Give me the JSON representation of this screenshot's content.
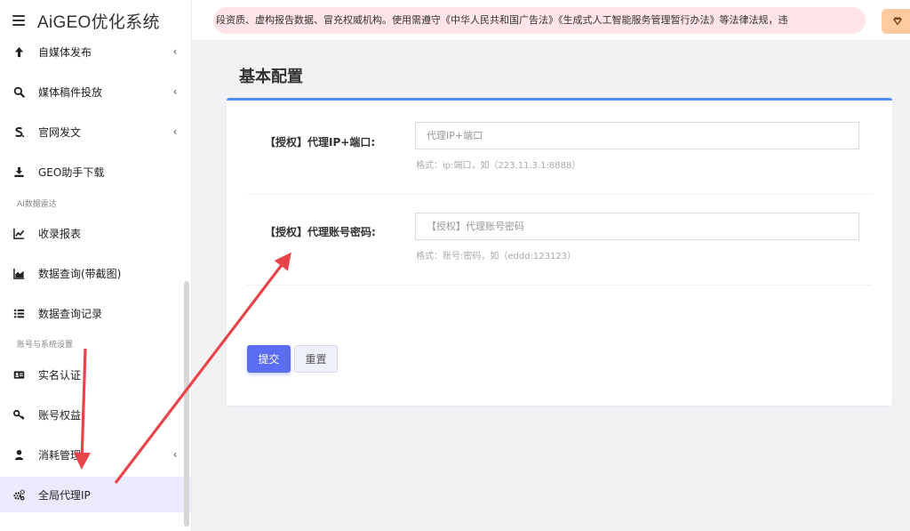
{
  "app": {
    "title": "AiGEO优化系统"
  },
  "sidebar": {
    "items": [
      {
        "label": "自媒体发布",
        "icon": "arrow-up-icon",
        "has_caret": true
      },
      {
        "label": "媒体稿件投放",
        "icon": "search-icon",
        "has_caret": true
      },
      {
        "label": "官网发文",
        "icon": "s-logo-icon",
        "has_caret": true
      },
      {
        "label": "GEO助手下载",
        "icon": "download-icon",
        "has_caret": false
      },
      {
        "label": "收录报表",
        "icon": "line-chart-icon",
        "has_caret": false
      },
      {
        "label": "数据查询(带截图)",
        "icon": "area-chart-icon",
        "has_caret": false
      },
      {
        "label": "数据查询记录",
        "icon": "list-icon",
        "has_caret": false
      },
      {
        "label": "实名认证",
        "icon": "id-card-icon",
        "has_caret": false
      },
      {
        "label": "账号权益",
        "icon": "key-icon",
        "has_caret": false
      },
      {
        "label": "消耗管理",
        "icon": "user-icon",
        "has_caret": true
      },
      {
        "label": "全局代理IP",
        "icon": "cogs-icon",
        "has_caret": false,
        "active": true
      }
    ],
    "sections": {
      "ai_radar": "AI数据雷达",
      "account_settings": "账号与系统设置"
    },
    "caret_glyph": "‹"
  },
  "topbar": {
    "notice": "段资质、虚构报告数据、冒充权威机构。使用需遵守《中华人民共和国广告法》《生成式人工智能服务管理暂行办法》等法律法规，违",
    "vip_icon": "diamond-icon"
  },
  "main": {
    "page_title": "基本配置",
    "fields": [
      {
        "label": "【授权】代理IP+端口:",
        "placeholder": "代理IP+端口",
        "value": "",
        "hint": "格式：ip:端口，如（223.11.3.1:8888）"
      },
      {
        "label": "【授权】代理账号密码:",
        "placeholder": "【授权】代理账号密码",
        "value": "",
        "hint": "格式：账号:密码，如（eddd:123123）"
      }
    ],
    "buttons": {
      "submit": "提交",
      "reset": "重置"
    }
  },
  "colors": {
    "accent": "#5b6cf5",
    "card_top_border": "#4d8ff6",
    "active_nav_bg": "#ebeaff",
    "notice_bg": "#ffe4e8",
    "vip_bg": "#ffcaa0",
    "annotation_arrow": "#e8454a"
  }
}
